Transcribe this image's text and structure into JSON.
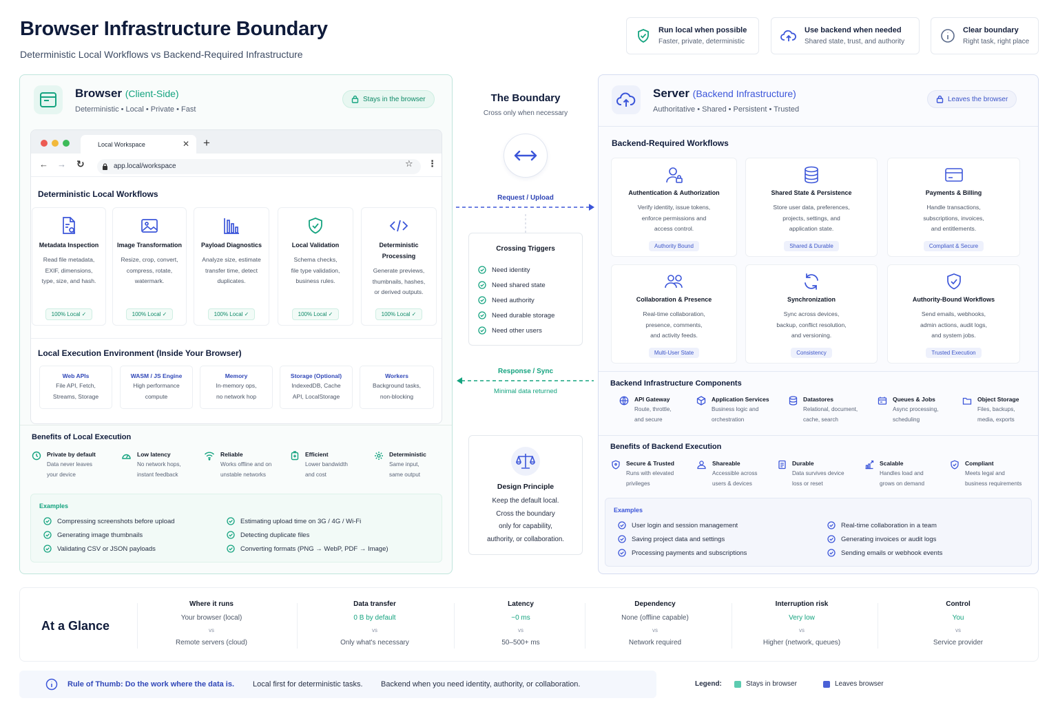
{
  "header": {
    "title": "Browser Infrastructure Boundary",
    "subtitle": "Deterministic Local Workflows vs Backend-Required Infrastructure"
  },
  "principles": [
    {
      "icon": "shield-check-icon",
      "title": "Run local when possible",
      "desc": "Faster, private, deterministic"
    },
    {
      "icon": "cloud-upload-icon",
      "title": "Use backend when needed",
      "desc": "Shared state, trust, and authority"
    },
    {
      "icon": "info-icon",
      "title": "Clear boundary",
      "desc": "Right task, right place"
    }
  ],
  "browser": {
    "title": "Browser",
    "title_suffix": "(Client-Side)",
    "subtitle": "Deterministic • Local • Private • Fast",
    "tag": "Stays in the browser",
    "tab_title": "Local Workspace",
    "url": "app.local/workspace",
    "workflows_heading": "Deterministic Local Workflows",
    "workflows": [
      {
        "icon": "file-search-icon",
        "title": "Metadata Inspection",
        "desc": [
          "Read file metadata,",
          "EXIF, dimensions,",
          "type, size, and hash."
        ],
        "badge": "100% Local"
      },
      {
        "icon": "image-icon",
        "title": "Image Transformation",
        "desc": [
          "Resize, crop, convert,",
          "compress, rotate,",
          "watermark."
        ],
        "badge": "100% Local"
      },
      {
        "icon": "bar-chart-icon",
        "title": "Payload Diagnostics",
        "desc": [
          "Analyze size, estimate",
          "transfer time, detect",
          "duplicates."
        ],
        "badge": "100% Local"
      },
      {
        "icon": "shield-check-icon",
        "title": "Local Validation",
        "desc": [
          "Schema checks,",
          "file type validation,",
          "business rules."
        ],
        "badge": "100% Local"
      },
      {
        "icon": "code-icon",
        "title": "Deterministic Processing",
        "desc": [
          "Generate previews,",
          "thumbnails, hashes,",
          "or derived outputs."
        ],
        "badge": "100% Local"
      }
    ],
    "env_heading": "Local Execution Environment (Inside Your Browser)",
    "env": [
      {
        "title": "Web APIs",
        "desc": [
          "File API, Fetch,",
          "Streams, Storage"
        ]
      },
      {
        "title": "WASM / JS Engine",
        "desc": [
          "High performance",
          "compute"
        ]
      },
      {
        "title": "Memory",
        "desc": [
          "In-memory ops,",
          "no network hop"
        ]
      },
      {
        "title": "Storage (Optional)",
        "desc": [
          "IndexedDB, Cache",
          "API, LocalStorage"
        ]
      },
      {
        "title": "Workers",
        "desc": [
          "Background tasks,",
          "non-blocking"
        ]
      }
    ],
    "benefits_heading": "Benefits of Local Execution",
    "benefits": [
      {
        "icon": "clock-icon",
        "title": "Private by default",
        "desc": [
          "Data never leaves",
          "your device"
        ]
      },
      {
        "icon": "gauge-icon",
        "title": "Low latency",
        "desc": [
          "No network hops,",
          "instant feedback"
        ]
      },
      {
        "icon": "wifi-icon",
        "title": "Reliable",
        "desc": [
          "Works offline and on",
          "unstable networks"
        ]
      },
      {
        "icon": "battery-icon",
        "title": "Efficient",
        "desc": [
          "Lower bandwidth",
          "and cost"
        ]
      },
      {
        "icon": "gear-icon",
        "title": "Deterministic",
        "desc": [
          "Same input,",
          "same output"
        ]
      }
    ],
    "examples_label": "Examples",
    "examples": [
      "Compressing screenshots before upload",
      "Generating image thumbnails",
      "Validating CSV or JSON payloads",
      "Estimating upload time on 3G / 4G / Wi-Fi",
      "Detecting duplicate files",
      "Converting formats (PNG → WebP, PDF → Image)"
    ]
  },
  "boundary": {
    "title": "The Boundary",
    "subtitle": "Cross only when necessary",
    "request_label": "Request / Upload",
    "response_label": "Response / Sync",
    "response_sub": "Minimal data returned",
    "triggers_heading": "Crossing Triggers",
    "triggers": [
      "Need identity",
      "Need shared state",
      "Need authority",
      "Need durable storage",
      "Need other users"
    ],
    "principle_heading": "Design Principle",
    "principle_lines": [
      "Keep the default local.",
      "Cross the boundary",
      "only for capability,",
      "authority, or collaboration."
    ]
  },
  "server": {
    "title": "Server",
    "title_suffix": "(Backend Infrastructure)",
    "subtitle": "Authoritative • Shared • Persistent • Trusted",
    "tag": "Leaves the browser",
    "workflows_heading": "Backend-Required Workflows",
    "workflows": [
      {
        "icon": "user-lock-icon",
        "title": "Authentication & Authorization",
        "desc": [
          "Verify identity, issue tokens,",
          "enforce permissions and",
          "access control."
        ],
        "badge": "Authority Bound"
      },
      {
        "icon": "database-icon",
        "title": "Shared State & Persistence",
        "desc": [
          "Store user data, preferences,",
          "projects, settings, and",
          "application state."
        ],
        "badge": "Shared & Durable"
      },
      {
        "icon": "credit-card-icon",
        "title": "Payments & Billing",
        "desc": [
          "Handle transactions,",
          "subscriptions, invoices,",
          "and entitlements."
        ],
        "badge": "Compliant & Secure"
      },
      {
        "icon": "users-icon",
        "title": "Collaboration & Presence",
        "desc": [
          "Real-time collaboration,",
          "presence, comments,",
          "and activity feeds."
        ],
        "badge": "Multi-User State"
      },
      {
        "icon": "sync-icon",
        "title": "Synchronization",
        "desc": [
          "Sync across devices,",
          "backup, conflict resolution,",
          "and versioning."
        ],
        "badge": "Consistency"
      },
      {
        "icon": "shield-check-icon",
        "title": "Authority-Bound Workflows",
        "desc": [
          "Send emails, webhooks,",
          "admin actions, audit logs,",
          "and system jobs."
        ],
        "badge": "Trusted Execution"
      }
    ],
    "components_heading": "Backend Infrastructure Components",
    "components": [
      {
        "icon": "globe-icon",
        "title": "API Gateway",
        "desc": [
          "Route, throttle,",
          "and secure"
        ]
      },
      {
        "icon": "cube-icon",
        "title": "Application Services",
        "desc": [
          "Business logic and",
          "orchestration"
        ]
      },
      {
        "icon": "database-icon",
        "title": "Datastores",
        "desc": [
          "Relational, document,",
          "cache, search"
        ]
      },
      {
        "icon": "queue-icon",
        "title": "Queues & Jobs",
        "desc": [
          "Async processing,",
          "scheduling"
        ]
      },
      {
        "icon": "folder-icon",
        "title": "Object Storage",
        "desc": [
          "Files, backups,",
          "media, exports"
        ]
      }
    ],
    "benefits_heading": "Benefits of Backend Execution",
    "benefits": [
      {
        "icon": "shield-icon",
        "title": "Secure & Trusted",
        "desc": [
          "Runs with elevated",
          "privileges"
        ]
      },
      {
        "icon": "users-icon",
        "title": "Shareable",
        "desc": [
          "Accessible across",
          "users & devices"
        ]
      },
      {
        "icon": "document-icon",
        "title": "Durable",
        "desc": [
          "Data survives device",
          "loss or reset"
        ]
      },
      {
        "icon": "scale-up-icon",
        "title": "Scalable",
        "desc": [
          "Handles load and",
          "grows on demand"
        ]
      },
      {
        "icon": "badge-check-icon",
        "title": "Compliant",
        "desc": [
          "Meets legal and",
          "business requirements"
        ]
      }
    ],
    "examples_label": "Examples",
    "examples": [
      "User login and session management",
      "Saving project data and settings",
      "Processing payments and subscriptions",
      "Real-time collaboration in a team",
      "Generating invoices or audit logs",
      "Sending emails or webhook events"
    ]
  },
  "glance": {
    "title": "At a Glance",
    "vs": "vs",
    "columns": [
      {
        "heading": "Where it runs",
        "local": "Your browser (local)",
        "server": "Remote servers (cloud)"
      },
      {
        "heading": "Data transfer",
        "local": "0 B by default",
        "server": "Only what's necessary"
      },
      {
        "heading": "Latency",
        "local": "~0 ms",
        "server": "50–500+ ms"
      },
      {
        "heading": "Dependency",
        "local": "None (offline capable)",
        "server": "Network required"
      },
      {
        "heading": "Interruption risk",
        "local": "Very low",
        "server": "Higher (network, queues)"
      },
      {
        "heading": "Control",
        "local": "You",
        "server": "Service provider"
      }
    ]
  },
  "footer": {
    "rule": "Rule of Thumb: Do the work where the data is.",
    "rule_local": "Local first for deterministic tasks.",
    "rule_backend": "Backend when you need identity, authority, or collaboration.",
    "legend_label": "Legend:",
    "legend_local": "Stays in browser",
    "legend_server": "Leaves browser"
  },
  "colors": {
    "local_accent": "#14a37f",
    "server_accent": "#3b55d9",
    "heading": "#0f1b3a"
  }
}
